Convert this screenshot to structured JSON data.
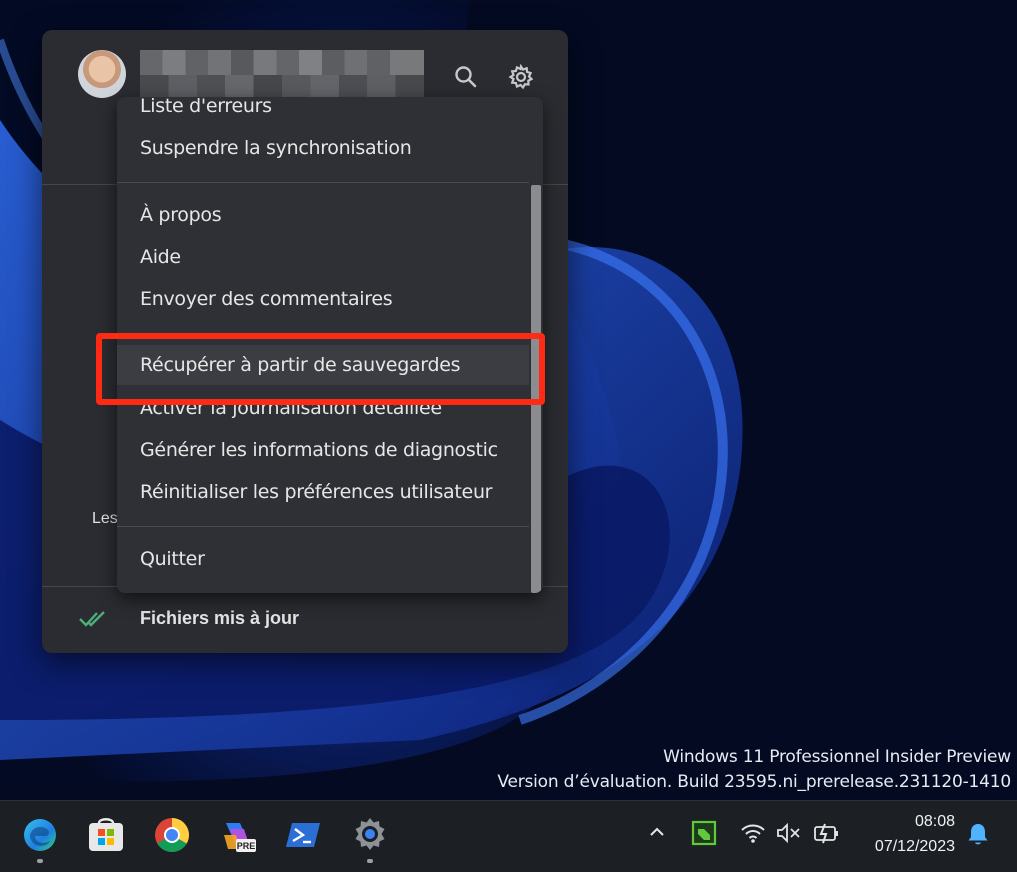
{
  "desktop": {
    "watermark_line1": "Windows 11 Professionnel Insider Preview",
    "watermark_line2": "Version d’évaluation. Build 23595.ni_prerelease.231120-1410"
  },
  "drive_panel": {
    "partial_text": "Les",
    "status_label": "Fichiers mis à jour",
    "icons": {
      "search": "search-icon",
      "settings": "gear-icon",
      "status": "double-check-icon"
    }
  },
  "menu": {
    "items": [
      "Liste d'erreurs",
      "Suspendre la synchronisation",
      "À propos",
      "Aide",
      "Envoyer des commentaires",
      "Récupérer à partir de sauvegardes",
      "Activer la journalisation détaillée",
      "Générer les informations de diagnostic",
      "Réinitialiser les préférences utilisateur",
      "Quitter"
    ],
    "highlighted_item": "Récupérer à partir de sauvegardes"
  },
  "taskbar": {
    "apps": [
      "edge-icon",
      "store-icon",
      "chrome-icon",
      "copilot-icon",
      "terminal-icon",
      "settings-app-icon"
    ],
    "copilot_badge": "PRE",
    "tray_icons": [
      "chevron-up-icon",
      "app-tray-icon",
      "wifi-icon",
      "volume-muted-icon",
      "battery-charging-icon",
      "bell-icon"
    ],
    "time": "08:08",
    "date": "07/12/2023"
  },
  "colors": {
    "panel_bg": "#2a2c31",
    "menu_bg": "#2f3035",
    "highlight": "#ff2a13",
    "status_check": "#4caf7a"
  }
}
